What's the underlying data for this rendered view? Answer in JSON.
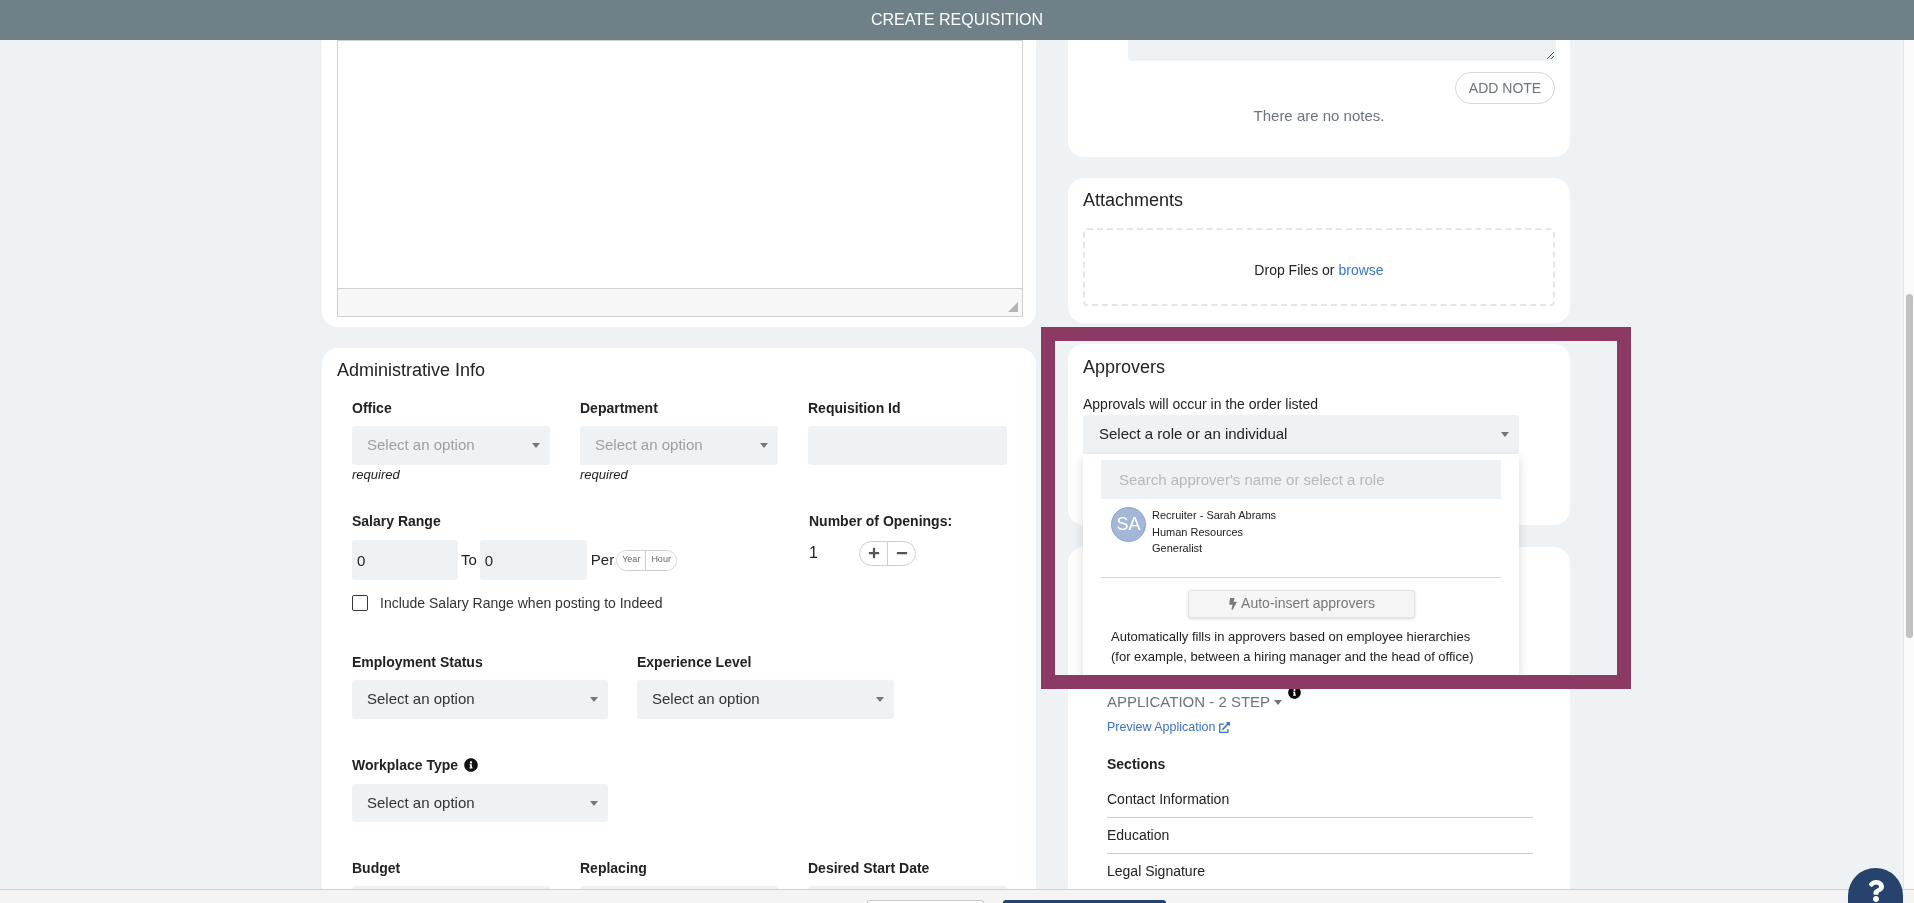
{
  "header": {
    "title": "CREATE REQUISITION"
  },
  "administrative_info": {
    "title": "Administrative Info",
    "top_fields": [
      {
        "kind": "select",
        "label": "Office",
        "placeholder": "Select an option",
        "note": "required"
      },
      {
        "kind": "select",
        "label": "Department",
        "placeholder": "Select an option",
        "note": "required"
      },
      {
        "kind": "text",
        "label": "Requisition Id"
      }
    ],
    "salary_range": {
      "label": "Salary Range",
      "from": "0",
      "separator": "To",
      "to": "0",
      "per": "Per",
      "units": [
        {
          "label": "Year",
          "selected": false
        },
        {
          "label": "Hour",
          "selected": false
        }
      ]
    },
    "openings": {
      "label": "Number of Openings:",
      "value": "1"
    },
    "include_salary": {
      "label": "Include Salary Range when posting to Indeed",
      "checked": false
    },
    "middle_fields": [
      {
        "label": "Employment Status",
        "value": "Select an option"
      },
      {
        "label": "Experience Level",
        "value": "Select an option"
      }
    ],
    "workplace_type": {
      "label": "Workplace Type",
      "value": "Select an option"
    },
    "bottom_fields": [
      {
        "label": "Budget"
      },
      {
        "label": "Replacing"
      },
      {
        "label": "Desired Start Date"
      }
    ]
  },
  "notes": {
    "add_button": "ADD NOTE",
    "empty_message": "There are no notes."
  },
  "attachments": {
    "title": "Attachments",
    "drop_text": "Drop Files or",
    "browse_link": "browse"
  },
  "approvers": {
    "title": "Approvers",
    "subtitle": "Approvals will occur in the order listed",
    "select": {
      "value": "Select a role or an individual",
      "expanded": true
    },
    "dropdown": {
      "search_placeholder": "Search approver's name or select a role",
      "options": [
        {
          "initials": "SA",
          "lines": [
            "Recruiter - Sarah Abrams",
            "Human Resources",
            "Generalist"
          ]
        }
      ],
      "auto_insert_button": "Auto-insert approvers",
      "description": "Automatically fills in approvers based on employee hierarchies (for example, between a hiring manager and the head of office)"
    }
  },
  "application": {
    "type": "APPLICATION - 2 STEP",
    "preview_link": "Preview Application",
    "sections_title": "Sections",
    "sections": [
      "Contact Information",
      "Education",
      "Legal Signature"
    ]
  }
}
